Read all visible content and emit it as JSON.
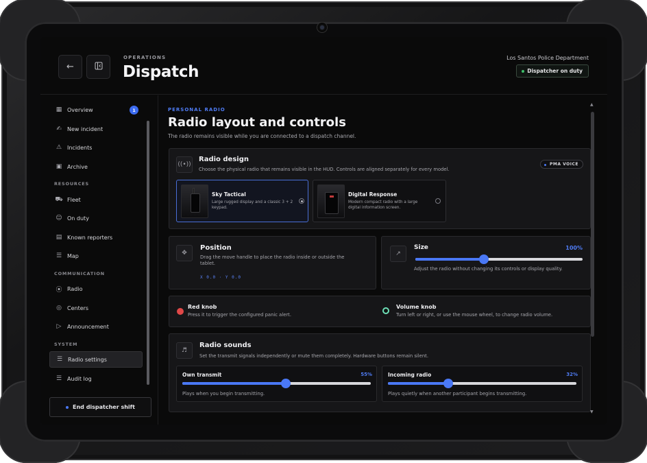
{
  "header": {
    "eyebrow": "OPERATIONS",
    "title": "Dispatch",
    "department": "Los Santos Police Department",
    "status": "Dispatcher on duty",
    "back_icon": "arrow-left-icon",
    "panel_icon": "sidebar-toggle-icon"
  },
  "sidebar": {
    "items_main": [
      {
        "label": "Overview",
        "icon": "grid-icon",
        "badge": "1"
      },
      {
        "label": "New incident",
        "icon": "file-plus-icon"
      },
      {
        "label": "Incidents",
        "icon": "alarm-icon"
      },
      {
        "label": "Archive",
        "icon": "archive-icon"
      }
    ],
    "section_resources": "RESOURCES",
    "items_resources": [
      {
        "label": "Fleet",
        "icon": "truck-icon"
      },
      {
        "label": "On duty",
        "icon": "users-icon"
      },
      {
        "label": "Known reporters",
        "icon": "contact-book-icon"
      },
      {
        "label": "Map",
        "icon": "map-icon"
      }
    ],
    "section_communication": "COMMUNICATION",
    "items_communication": [
      {
        "label": "Radio",
        "icon": "radio-waves-icon"
      },
      {
        "label": "Centers",
        "icon": "broadcast-icon"
      },
      {
        "label": "Announcement",
        "icon": "megaphone-icon"
      }
    ],
    "section_system": "SYSTEM",
    "items_system": [
      {
        "label": "Radio settings",
        "icon": "sliders-icon",
        "active": true
      },
      {
        "label": "Audit log",
        "icon": "list-icon"
      }
    ],
    "end_shift": "End dispatcher shift"
  },
  "main": {
    "eyebrow": "PERSONAL RADIO",
    "title": "Radio layout and controls",
    "subtitle": "The radio remains visible while you are connected to a dispatch channel.",
    "design": {
      "title": "Radio design",
      "text": "Choose the physical radio that remains visible in the HUD. Controls are aligned separately for every model.",
      "badge": "PMA VOICE",
      "options": [
        {
          "title": "Sky Tactical",
          "text1": "Large rugged display and a classic 3 + 2",
          "text2": "keypad.",
          "selected": true
        },
        {
          "title": "Digital Response",
          "text1": "Modern compact radio with a large",
          "text2": "digital information screen.",
          "selected": false
        }
      ]
    },
    "position": {
      "title": "Position",
      "text1": "Drag the move handle to place the radio inside or outside the",
      "text2": "tablet.",
      "coords": "X 0.0 · Y 0.0"
    },
    "size": {
      "title": "Size",
      "percent_label": "100%",
      "value": 1.0,
      "text": "Adjust the radio without changing its controls or display quality."
    },
    "knobs": {
      "red_title": "Red knob",
      "red_text": "Press it to trigger the configured panic alert.",
      "vol_title": "Volume knob",
      "vol_text": "Turn left or right, or use the mouse wheel, to change radio volume."
    },
    "sounds": {
      "title": "Radio sounds",
      "text": "Set the transmit signals independently or mute them completely. Hardware buttons remain silent.",
      "own": {
        "title": "Own transmit",
        "percent_label": "55%",
        "value": 0.55,
        "text": "Plays when you begin transmitting."
      },
      "incoming": {
        "title": "Incoming radio",
        "percent_label": "32%",
        "value": 0.32,
        "text": "Plays quietly when another participant begins transmitting."
      }
    }
  },
  "colors": {
    "accent": "#4a78f5",
    "duty_green": "#3fbf6a",
    "panic_red": "#e04848",
    "volume_ring": "#6fe0b8"
  }
}
